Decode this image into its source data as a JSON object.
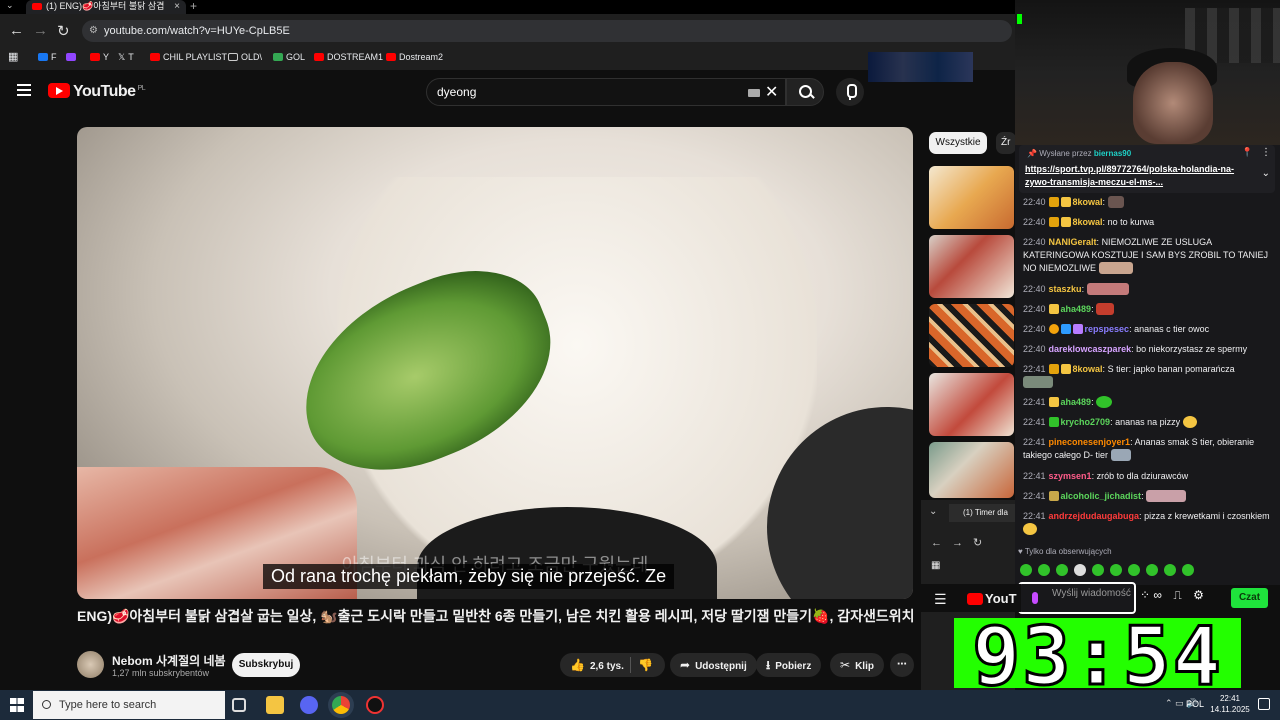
{
  "browser": {
    "tab_title": "(1) ENG)🥩아침부터 불닭 삼겹",
    "url": "youtube.com/watch?v=HUYe-CpLB5E",
    "bookmarks": [
      {
        "label": "F",
        "color": "#1877f2"
      },
      {
        "label": "",
        "color": "#9146ff"
      },
      {
        "label": "Y",
        "color": "#ff0000"
      },
      {
        "label": "T",
        "color": "#555555"
      },
      {
        "label": "CHIL PLAYLIST",
        "color": "#ff0000"
      },
      {
        "label": "OLD\\",
        "color": "#888888"
      },
      {
        "label": "GOL",
        "color": "#34a853"
      },
      {
        "label": "DOSTREAM1",
        "color": "#ff0000"
      },
      {
        "label": "Dostream2",
        "color": "#ff0000"
      }
    ]
  },
  "youtube": {
    "logo": "YouTube",
    "region": "PL",
    "search_query": "dyeong",
    "subtitle_ko": "아침부터 과식 안 하려고 조금만 구웠는데",
    "subtitle_pl": "Od rana trochę piekłam, żeby się nie przejeść. Ze",
    "video_title": "ENG)🥩아침부터 불닭 삼겹살 굽는 일상, 🐿️출근 도시락 만들고 밑반찬 6종 만들기, 남은 치킨 활용 레시피, 저당 딸기잼 만들기🍓, 감자샌드위치",
    "channel_name": "Nebom 사계절의 네봄",
    "channel_subs": "1,27 mln subskrybentów",
    "subscribe_label": "Subskrybuj",
    "likes": "2,6 tys.",
    "share_label": "Udostępnij",
    "download_label": "Pobierz",
    "clip_label": "Klip",
    "chip_all": "Wszystkie",
    "chip_2": "Źr"
  },
  "chat": {
    "pinned_by": "Wysłane przez",
    "pinned_user": "biernas90",
    "pinned_link": "https://sport.tvp.pl/89772764/polska-holandia-na-zywo-transmisja-meczu-el-ms-...",
    "messages": [
      {
        "time": "22:40",
        "user": "8kowal",
        "color": "#f4c542",
        "text": ""
      },
      {
        "time": "22:40",
        "user": "8kowal",
        "color": "#f4c542",
        "text": "no to kurwa"
      },
      {
        "time": "22:40",
        "user": "NANIGeralt",
        "color": "#f4c542",
        "text": "NIEMOZLIWE ZE USLUGA KATERINGOWA KOSZTUJE I SAM BYS ZROBIL TO TANIEJ NO NIEMOZLIWE"
      },
      {
        "time": "22:40",
        "user": "staszku",
        "color": "#f4c542",
        "text": ""
      },
      {
        "time": "22:40",
        "user": "aha489",
        "color": "#5cd65c",
        "text": ""
      },
      {
        "time": "22:40",
        "user": "repspesec",
        "color": "#8a7dff",
        "text": "ananas c tier owoc"
      },
      {
        "time": "22:40",
        "user": "dareklowcaszparek",
        "color": "#d6a3ff",
        "text": "bo niekorzystasz ze spermy"
      },
      {
        "time": "22:41",
        "user": "8kowal",
        "color": "#f4c542",
        "text": "S tier: japko banan pomarańcza"
      },
      {
        "time": "22:41",
        "user": "aha489",
        "color": "#5cd65c",
        "text": ""
      },
      {
        "time": "22:41",
        "user": "krycho2709",
        "color": "#5cd65c",
        "text": "ananas na pizzy"
      },
      {
        "time": "22:41",
        "user": "pineconesenjoyer1",
        "color": "#ff8a00",
        "text": "Ananas smak S tier, obieranie takiego całego D- tier"
      },
      {
        "time": "22:41",
        "user": "szymsen1",
        "color": "#ff5c8a",
        "text": "zrób to dla dziurawców"
      },
      {
        "time": "22:41",
        "user": "alcoholic_jichadist",
        "color": "#5cd65c",
        "text": ""
      },
      {
        "time": "22:41",
        "user": "andrzejdudaugabuga",
        "color": "#ff3b3b",
        "text": "pizza z krewetkami i czosnkiem"
      }
    ],
    "followers_only": "Tylko dla obserwujących",
    "input_placeholder": "Wyślij wiadomość",
    "send_label": "Czat"
  },
  "mini_browser": {
    "tab_title": "(1) Timer dla"
  },
  "timer": "93:54",
  "taskbar": {
    "search_placeholder": "Type here to search",
    "lang": "POL",
    "time": "22:41",
    "date": "14.11.2025"
  }
}
